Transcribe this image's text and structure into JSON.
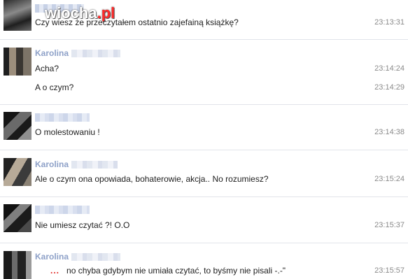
{
  "watermark": {
    "text": "wiocha",
    "suffix": ".pl"
  },
  "messages": [
    {
      "sender": "",
      "lines": [
        {
          "text": "Czy wiesz że przeczytałem ostatnio zajefainą książkę?",
          "time": "23:13:31"
        }
      ]
    },
    {
      "sender": "Karolina",
      "lines": [
        {
          "text": "Acha?",
          "time": "23:14:24"
        },
        {
          "text": "A o czym?",
          "time": "23:14:29"
        }
      ]
    },
    {
      "sender": "",
      "lines": [
        {
          "text": "O molestowaniu !",
          "time": "23:14:38"
        }
      ]
    },
    {
      "sender": "Karolina",
      "lines": [
        {
          "text": "Ale o czym ona opowiada, bohaterowie, akcja.. No rozumiesz?",
          "time": "23:15:24"
        }
      ]
    },
    {
      "sender": "",
      "lines": [
        {
          "text": "Nie umiesz czytać ?! O.O",
          "time": "23:15:37"
        }
      ]
    },
    {
      "sender": "Karolina",
      "lines": [
        {
          "text": "no chyba gdybym nie umiała czytać, to byśmy nie pisali -.-\"",
          "time": "23:15:57",
          "prefix": "..."
        }
      ]
    }
  ]
}
